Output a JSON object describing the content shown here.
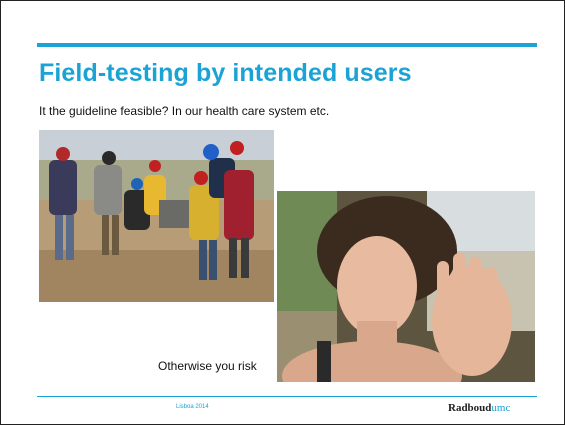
{
  "slide": {
    "title": "Field-testing by intended users",
    "subtitle": "It the guideline feasible? In our health care system etc.",
    "caption": "Otherwise you risk",
    "footer_text": "Lisboa 2014",
    "logo_part1": "Radboud",
    "logo_part2": "umc"
  },
  "colors": {
    "accent": "#1aa3d4",
    "text": "#111111"
  },
  "images": {
    "left": "field-workers-photo",
    "right": "woman-hand-raised-photo"
  }
}
